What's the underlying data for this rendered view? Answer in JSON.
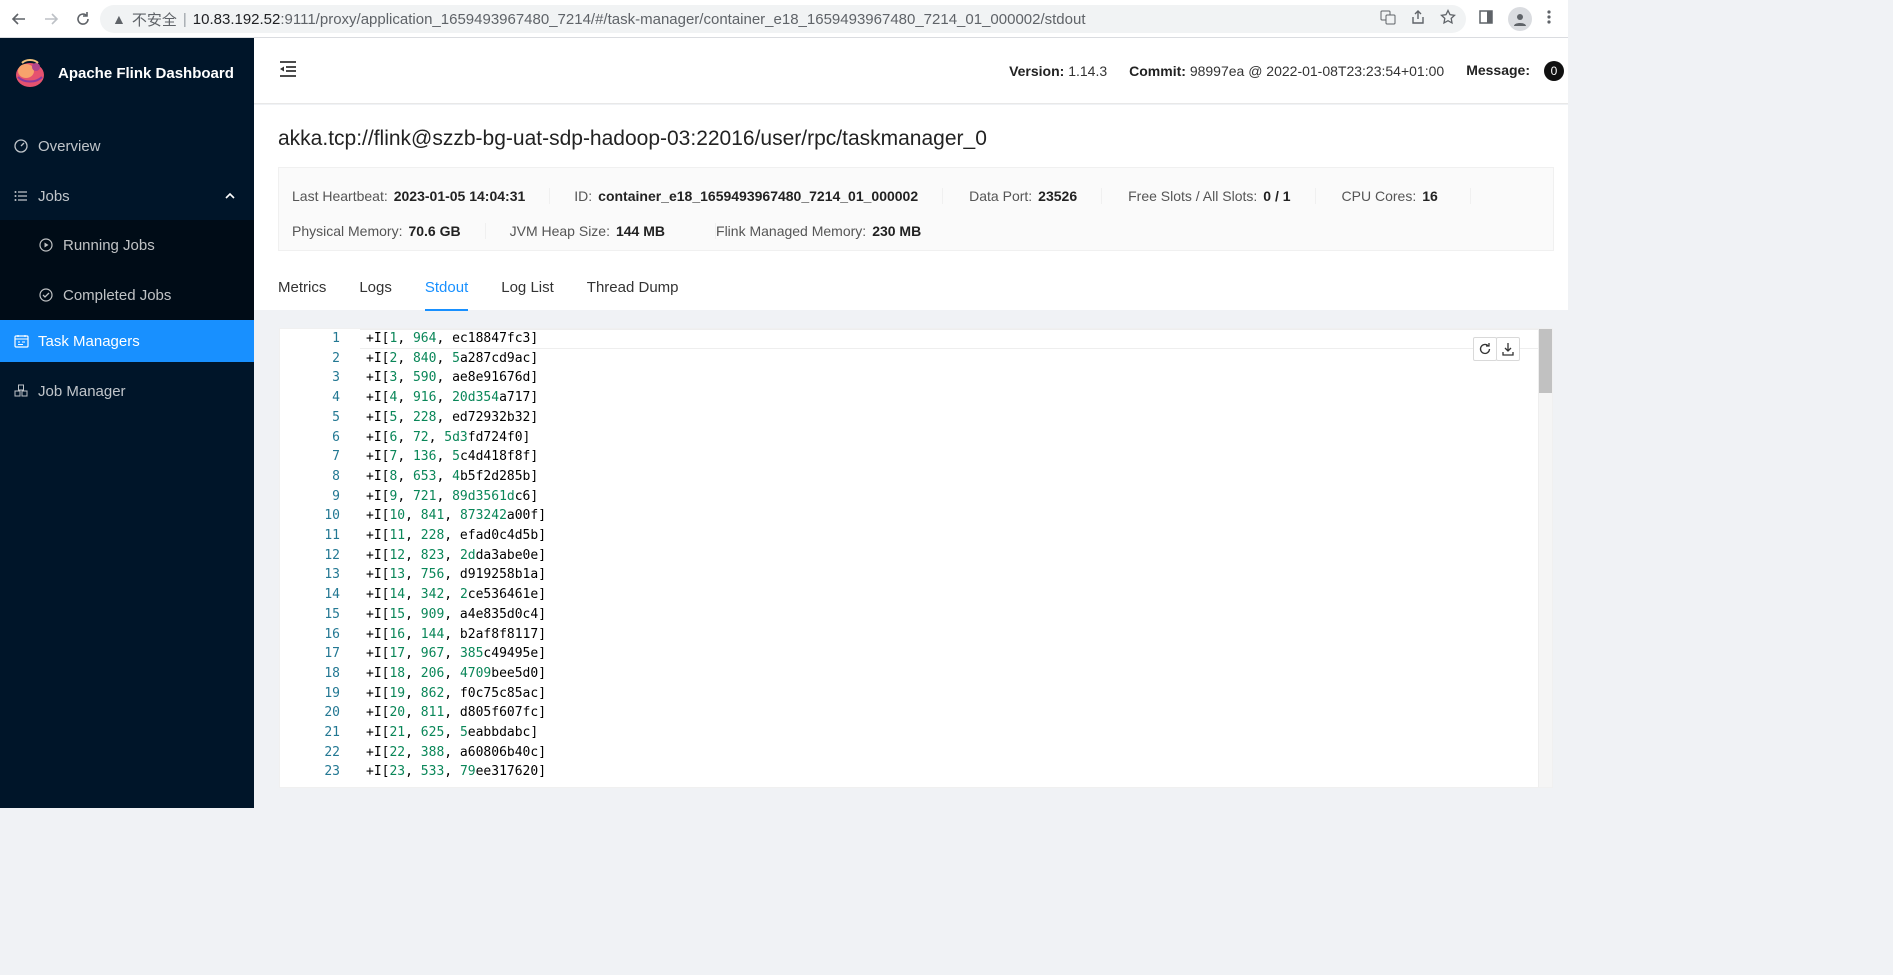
{
  "browser": {
    "insecure_label": "不安全",
    "separator": "|",
    "url_host": "10.83.192.52",
    "url_path": ":9111/proxy/application_1659493967480_7214/#/task-manager/container_e18_1659493967480_7214_01_000002/stdout"
  },
  "sidebar": {
    "title": "Apache Flink Dashboard",
    "items": [
      {
        "label": "Overview",
        "icon": "dashboard-icon"
      },
      {
        "label": "Jobs",
        "icon": "list-icon"
      },
      {
        "label": "Running Jobs",
        "icon": "play-circle-icon"
      },
      {
        "label": "Completed Jobs",
        "icon": "check-circle-icon"
      },
      {
        "label": "Task Managers",
        "icon": "schedule-icon"
      },
      {
        "label": "Job Manager",
        "icon": "cluster-icon"
      }
    ],
    "active_color": "#1890ff"
  },
  "header": {
    "version_label": "Version:",
    "version_value": "1.14.3",
    "commit_label": "Commit:",
    "commit_value": "98997ea @ 2022-01-08T23:23:54+01:00",
    "message_label": "Message:",
    "message_count": "0"
  },
  "taskmanager": {
    "title": "akka.tcp://flink@szzb-bg-uat-sdp-hadoop-03:22016/user/rpc/taskmanager_0",
    "row1": [
      {
        "k": "Last Heartbeat:",
        "v": "2023-01-05 14:04:31"
      },
      {
        "k": "ID:",
        "v": "container_e18_1659493967480_7214_01_000002"
      },
      {
        "k": "Data Port:",
        "v": "23526"
      },
      {
        "k": "Free Slots / All Slots:",
        "v": "0 / 1"
      },
      {
        "k": "CPU Cores:",
        "v": "16"
      }
    ],
    "row2": [
      {
        "k": "Physical Memory:",
        "v": "70.6 GB"
      },
      {
        "k": "JVM Heap Size:",
        "v": "144 MB"
      },
      {
        "k": "Flink Managed Memory:",
        "v": "230 MB"
      }
    ]
  },
  "tabs": [
    {
      "label": "Metrics"
    },
    {
      "label": "Logs"
    },
    {
      "label": "Stdout",
      "active": true
    },
    {
      "label": "Log List"
    },
    {
      "label": "Thread Dump"
    }
  ],
  "stdout_lines": [
    {
      "ln": "1",
      "parts": [
        [
          "+I[",
          "t"
        ],
        [
          "1",
          "n"
        ],
        [
          ", ",
          "t"
        ],
        [
          "964",
          "n"
        ],
        [
          ", ec18847fc3]",
          "t"
        ]
      ]
    },
    {
      "ln": "2",
      "parts": [
        [
          "+I[",
          "t"
        ],
        [
          "2",
          "n"
        ],
        [
          ", ",
          "t"
        ],
        [
          "840",
          "n"
        ],
        [
          ", ",
          "t"
        ],
        [
          "5",
          "n"
        ],
        [
          "a287cd9ac]",
          "t"
        ]
      ]
    },
    {
      "ln": "3",
      "parts": [
        [
          "+I[",
          "t"
        ],
        [
          "3",
          "n"
        ],
        [
          ", ",
          "t"
        ],
        [
          "590",
          "n"
        ],
        [
          ", ae8e91676d]",
          "t"
        ]
      ]
    },
    {
      "ln": "4",
      "parts": [
        [
          "+I[",
          "t"
        ],
        [
          "4",
          "n"
        ],
        [
          ", ",
          "t"
        ],
        [
          "916",
          "n"
        ],
        [
          ", ",
          "t"
        ],
        [
          "20d354",
          "n"
        ],
        [
          "a717]",
          "t"
        ]
      ]
    },
    {
      "ln": "5",
      "parts": [
        [
          "+I[",
          "t"
        ],
        [
          "5",
          "n"
        ],
        [
          ", ",
          "t"
        ],
        [
          "228",
          "n"
        ],
        [
          ", ed72932b32]",
          "t"
        ]
      ]
    },
    {
      "ln": "6",
      "parts": [
        [
          "+I[",
          "t"
        ],
        [
          "6",
          "n"
        ],
        [
          ", ",
          "t"
        ],
        [
          "72",
          "n"
        ],
        [
          ", ",
          "t"
        ],
        [
          "5d3",
          "n"
        ],
        [
          "fd724f0]",
          "t"
        ]
      ]
    },
    {
      "ln": "7",
      "parts": [
        [
          "+I[",
          "t"
        ],
        [
          "7",
          "n"
        ],
        [
          ", ",
          "t"
        ],
        [
          "136",
          "n"
        ],
        [
          ", ",
          "t"
        ],
        [
          "5",
          "n"
        ],
        [
          "c4d418f8f]",
          "t"
        ]
      ]
    },
    {
      "ln": "8",
      "parts": [
        [
          "+I[",
          "t"
        ],
        [
          "8",
          "n"
        ],
        [
          ", ",
          "t"
        ],
        [
          "653",
          "n"
        ],
        [
          ", ",
          "t"
        ],
        [
          "4",
          "n"
        ],
        [
          "b5f2d285b]",
          "t"
        ]
      ]
    },
    {
      "ln": "9",
      "parts": [
        [
          "+I[",
          "t"
        ],
        [
          "9",
          "n"
        ],
        [
          ", ",
          "t"
        ],
        [
          "721",
          "n"
        ],
        [
          ", ",
          "t"
        ],
        [
          "89d3561d",
          "n"
        ],
        [
          "c6]",
          "t"
        ]
      ]
    },
    {
      "ln": "10",
      "parts": [
        [
          "+I[",
          "t"
        ],
        [
          "10",
          "n"
        ],
        [
          ", ",
          "t"
        ],
        [
          "841",
          "n"
        ],
        [
          ", ",
          "t"
        ],
        [
          "873242",
          "n"
        ],
        [
          "a00f]",
          "t"
        ]
      ]
    },
    {
      "ln": "11",
      "parts": [
        [
          "+I[",
          "t"
        ],
        [
          "11",
          "n"
        ],
        [
          ", ",
          "t"
        ],
        [
          "228",
          "n"
        ],
        [
          ", efad0c4d5b]",
          "t"
        ]
      ]
    },
    {
      "ln": "12",
      "parts": [
        [
          "+I[",
          "t"
        ],
        [
          "12",
          "n"
        ],
        [
          ", ",
          "t"
        ],
        [
          "823",
          "n"
        ],
        [
          ", ",
          "t"
        ],
        [
          "2d",
          "n"
        ],
        [
          "da3abe0e]",
          "t"
        ]
      ]
    },
    {
      "ln": "13",
      "parts": [
        [
          "+I[",
          "t"
        ],
        [
          "13",
          "n"
        ],
        [
          ", ",
          "t"
        ],
        [
          "756",
          "n"
        ],
        [
          ", d919258b1a]",
          "t"
        ]
      ]
    },
    {
      "ln": "14",
      "parts": [
        [
          "+I[",
          "t"
        ],
        [
          "14",
          "n"
        ],
        [
          ", ",
          "t"
        ],
        [
          "342",
          "n"
        ],
        [
          ", ",
          "t"
        ],
        [
          "2",
          "n"
        ],
        [
          "ce536461e]",
          "t"
        ]
      ]
    },
    {
      "ln": "15",
      "parts": [
        [
          "+I[",
          "t"
        ],
        [
          "15",
          "n"
        ],
        [
          ", ",
          "t"
        ],
        [
          "909",
          "n"
        ],
        [
          ", a4e835d0c4]",
          "t"
        ]
      ]
    },
    {
      "ln": "16",
      "parts": [
        [
          "+I[",
          "t"
        ],
        [
          "16",
          "n"
        ],
        [
          ", ",
          "t"
        ],
        [
          "144",
          "n"
        ],
        [
          ", b2af8f8117]",
          "t"
        ]
      ]
    },
    {
      "ln": "17",
      "parts": [
        [
          "+I[",
          "t"
        ],
        [
          "17",
          "n"
        ],
        [
          ", ",
          "t"
        ],
        [
          "967",
          "n"
        ],
        [
          ", ",
          "t"
        ],
        [
          "385",
          "n"
        ],
        [
          "c49495e]",
          "t"
        ]
      ]
    },
    {
      "ln": "18",
      "parts": [
        [
          "+I[",
          "t"
        ],
        [
          "18",
          "n"
        ],
        [
          ", ",
          "t"
        ],
        [
          "206",
          "n"
        ],
        [
          ", ",
          "t"
        ],
        [
          "4709",
          "n"
        ],
        [
          "bee5d0]",
          "t"
        ]
      ]
    },
    {
      "ln": "19",
      "parts": [
        [
          "+I[",
          "t"
        ],
        [
          "19",
          "n"
        ],
        [
          ", ",
          "t"
        ],
        [
          "862",
          "n"
        ],
        [
          ", f0c75c85ac]",
          "t"
        ]
      ]
    },
    {
      "ln": "20",
      "parts": [
        [
          "+I[",
          "t"
        ],
        [
          "20",
          "n"
        ],
        [
          ", ",
          "t"
        ],
        [
          "811",
          "n"
        ],
        [
          ", d805f607fc]",
          "t"
        ]
      ]
    },
    {
      "ln": "21",
      "parts": [
        [
          "+I[",
          "t"
        ],
        [
          "21",
          "n"
        ],
        [
          ", ",
          "t"
        ],
        [
          "625",
          "n"
        ],
        [
          ", ",
          "t"
        ],
        [
          "5",
          "n"
        ],
        [
          "eabbdabc]",
          "t"
        ]
      ]
    },
    {
      "ln": "22",
      "parts": [
        [
          "+I[",
          "t"
        ],
        [
          "22",
          "n"
        ],
        [
          ", ",
          "t"
        ],
        [
          "388",
          "n"
        ],
        [
          ", a60806b40c]",
          "t"
        ]
      ]
    },
    {
      "ln": "23",
      "parts": [
        [
          "+I[",
          "t"
        ],
        [
          "23",
          "n"
        ],
        [
          ", ",
          "t"
        ],
        [
          "533",
          "n"
        ],
        [
          ", ",
          "t"
        ],
        [
          "79",
          "n"
        ],
        [
          "ee317620]",
          "t"
        ]
      ]
    }
  ],
  "colors": {
    "sidebar_bg": "#001529",
    "accent": "#1890ff",
    "line_number": "#237893",
    "code_number": "#098658"
  }
}
